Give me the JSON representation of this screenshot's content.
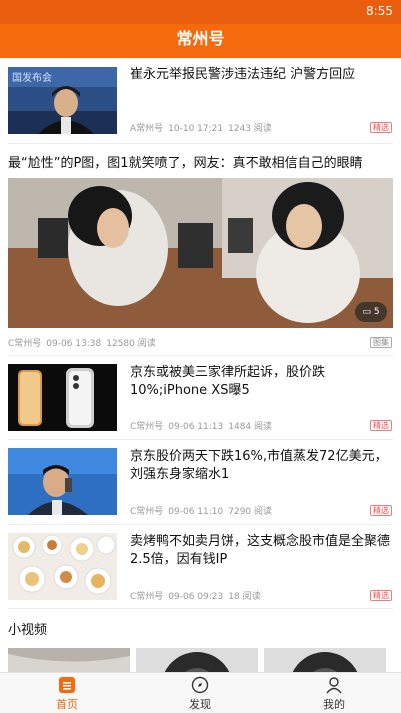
{
  "status_bar": {
    "time": "8:55"
  },
  "header": {
    "title": "常州号"
  },
  "colors": {
    "brand": "#f46a0c",
    "tag_red": "#e85555"
  },
  "feed": {
    "items": [
      {
        "title": "崔永元举报民警涉违法违纪 沪警方回应",
        "source": "A常州号",
        "time": "10-10 17:21",
        "reads": "1243 阅读",
        "tag": "精选",
        "thumb_icon": "press-conference-photo"
      },
      {
        "title": "京东或被美三家律所起诉，股价跌10%;iPhone XS曝5",
        "source": "C常州号",
        "time": "09-06 11:13",
        "reads": "1484 阅读",
        "tag": "精选",
        "thumb_icon": "iphone-photo"
      },
      {
        "title": "京东股价两天下跌16%,市值蒸发72亿美元，刘强东身家缩水1",
        "source": "C常州号",
        "time": "09-06 11:10",
        "reads": "7290 阅读",
        "tag": "精选",
        "thumb_icon": "phone-call-photo"
      },
      {
        "title": "卖烤鸭不如卖月饼，这支概念股市值是全聚德2.5倍，因有钱IP",
        "source": "C常州号",
        "time": "09-06 09:23",
        "reads": "18 阅读",
        "tag": "精选",
        "thumb_icon": "food-photo"
      }
    ],
    "gallery": {
      "title": "最“尬性”的P图，图1就笑喷了，网友：真不敢相信自己的眼睛",
      "image_count": "5",
      "source": "C常州号",
      "time": "09-06 13:38",
      "reads": "12580 阅读",
      "tag": "图集"
    }
  },
  "videos": {
    "section_title": "小视频"
  },
  "bottom_nav": {
    "items": [
      {
        "label": "首页",
        "icon": "home-doc-icon",
        "active": true
      },
      {
        "label": "发现",
        "icon": "compass-icon",
        "active": false
      },
      {
        "label": "我的",
        "icon": "person-icon",
        "active": false
      }
    ]
  }
}
